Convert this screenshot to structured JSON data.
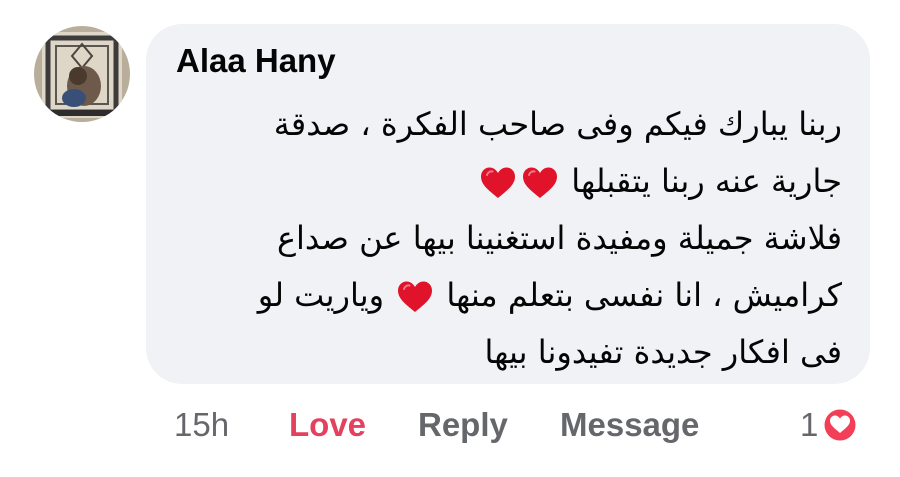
{
  "comment": {
    "author": "Alaa Hany",
    "avatar_icon": "profile-photo-prayer-rug",
    "lines": [
      {
        "text": "ربنا يبارك فيكم وفى صاحب الفكرة ، صدقة",
        "hearts_after": 0
      },
      {
        "text": "جارية عنه ربنا يتقبلها",
        "hearts_after": 2
      },
      {
        "text": "فلاشة جميلة ومفيدة استغنينا بيها عن صداع",
        "hearts_after": 0
      },
      {
        "text": "كراميش ، انا نفسى بتعلم منها",
        "hearts_after": 1,
        "text_after": "وياريت لو"
      },
      {
        "text": "فى افكار جديدة تفيدونا بيها",
        "hearts_after": 0
      }
    ],
    "heart_emoji_color": "#e0132b"
  },
  "actions": {
    "time": "15h",
    "love_label": "Love",
    "love_color": "#e4405f",
    "reply_label": "Reply",
    "message_label": "Message"
  },
  "reactions": {
    "count": "1",
    "icon": "love-reaction-icon",
    "color": "#f33e58"
  }
}
